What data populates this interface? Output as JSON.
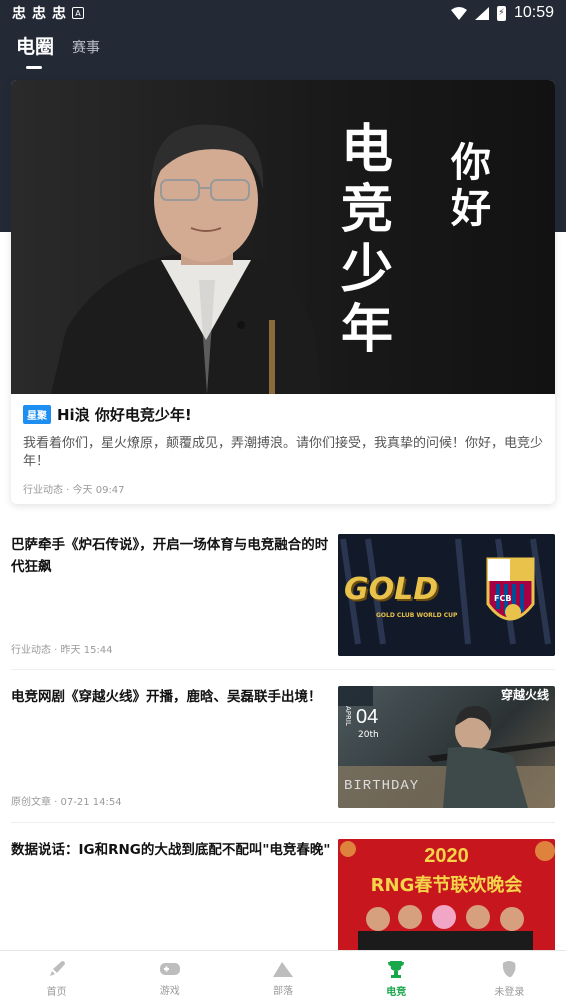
{
  "status_bar": {
    "time": "10:59",
    "notif_glyphs": [
      "忠",
      "忠",
      "忠"
    ],
    "a_icon_letter": "A",
    "battery_glyph": "⚡"
  },
  "tabs": [
    {
      "label": "电圈",
      "active": true
    },
    {
      "label": "赛事",
      "active": false
    }
  ],
  "feature": {
    "image_text": {
      "line1": "电竞少年",
      "line2": "你好"
    },
    "badge": "星聚",
    "title": "Hi浪 你好电竞少年!",
    "description": "我看着你们，星火燎原，颠覆成见，弄潮搏浪。请你们接受，我真挚的问候！你好，电竞少年！",
    "meta": "行业动态 · 今天 09:47"
  },
  "articles": [
    {
      "title": "巴萨牵手《炉石传说》，开启一场体育与电竞融合的时代狂飙",
      "meta": "行业动态 · 昨天 15:44",
      "thumb_texts": {
        "main": "GOLD",
        "sub": "GOLD CLUB WORLD CUP",
        "club": "FCB"
      }
    },
    {
      "title": "电竞网剧《穿越火线》开播，鹿晗、吴磊联手出境！",
      "meta": "原创文章 · 07-21 14:54",
      "thumb_texts": {
        "brand": "穿越火线",
        "day": "04",
        "date": "20th",
        "month": "APRIL",
        "bottom": "BIRTHDAY"
      }
    },
    {
      "title": "数据说话：IG和RNG的大战到底配不配叫\"电竞春晚\"",
      "meta": "",
      "thumb_texts": {
        "year": "2020",
        "event": "RNG春节联欢晚会"
      }
    }
  ],
  "bottom_nav": [
    {
      "label": "首页",
      "icon": "rocket-icon",
      "active": false
    },
    {
      "label": "游戏",
      "icon": "gamepad-icon",
      "active": false
    },
    {
      "label": "部落",
      "icon": "mountain-icon",
      "active": false
    },
    {
      "label": "电竞",
      "icon": "trophy-icon",
      "active": true
    },
    {
      "label": "未登录",
      "icon": "user-icon",
      "active": false
    }
  ],
  "colors": {
    "header_bg": "#232a36",
    "accent": "#1aa64b",
    "badge": "#1f8ef1"
  }
}
